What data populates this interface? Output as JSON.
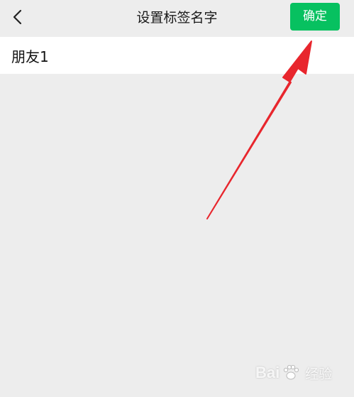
{
  "header": {
    "title": "设置标签名字",
    "confirm_label": "确定",
    "back_icon": "chevron-left-icon"
  },
  "tag_input": {
    "value": "朋友1"
  },
  "annotation": {
    "arrow_icon": "red-arrow-icon",
    "color": "#e8262d"
  },
  "watermark": {
    "left_text": "Bai",
    "right_text": "经验",
    "logo_icon": "paw-logo-icon"
  },
  "colors": {
    "accent": "#07c160",
    "background": "#ededed"
  }
}
